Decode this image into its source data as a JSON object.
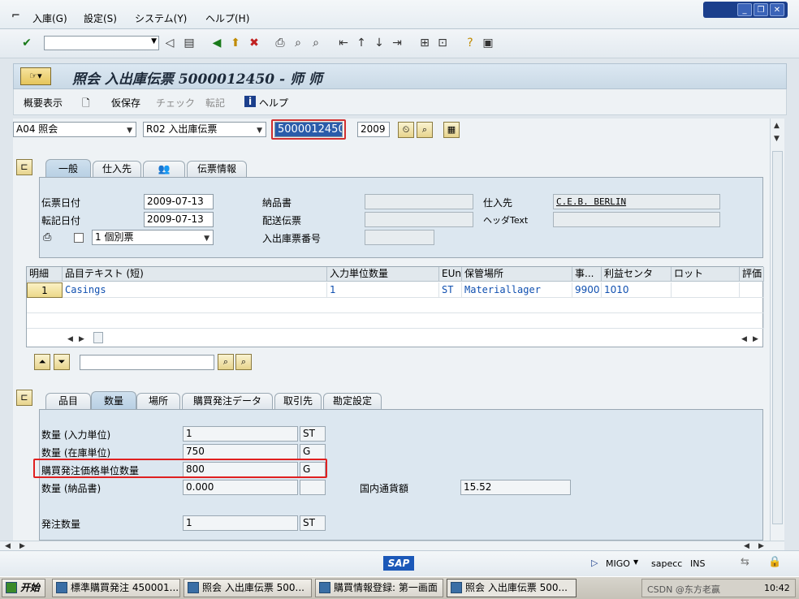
{
  "menubar": {
    "items": [
      "入庫(G)",
      "設定(S)",
      "システム(Y)",
      "ヘルプ(H)"
    ]
  },
  "toolbar": {
    "command_value": ""
  },
  "title": {
    "text": "照会 入出庫伝票 5000012450 - 师 师"
  },
  "app_toolbar": {
    "summary": "概要表示",
    "hold": "仮保存",
    "check": "チェック",
    "post": "転記",
    "help": "ヘルプ"
  },
  "header": {
    "action": "A04 照会",
    "ref_doc_type": "R02 入出庫伝票",
    "doc_number": "5000012450",
    "year": "2009"
  },
  "tabs_top": {
    "items": [
      "一般",
      "仕入先",
      "",
      "伝票情報"
    ],
    "active": 0
  },
  "general": {
    "doc_date_label": "伝票日付",
    "doc_date": "2009-07-13",
    "post_date_label": "転記日付",
    "post_date": "2009-07-13",
    "slip_select": "1 個別票",
    "delivery_note_label": "納品書",
    "bill_of_lading_label": "配送伝票",
    "gr_slip_label": "入出庫票番号",
    "vendor_label": "仕入先",
    "vendor_value": "C.E.B. BERLIN",
    "header_text_label": "ヘッダText"
  },
  "items_grid": {
    "columns": [
      "明細",
      "品目テキスト (短)",
      "入力単位数量",
      "EUn",
      "保管場所",
      "事...",
      "利益センタ",
      "ロット",
      "評価"
    ],
    "rows": [
      {
        "line": "1",
        "text": "Casings",
        "qty": "1",
        "eun": "ST",
        "sloc": "Materiallager",
        "bus": "9900",
        "profit": "1010",
        "batch": "",
        "val": ""
      }
    ]
  },
  "tabs_bottom": {
    "items": [
      "品目",
      "数量",
      "場所",
      "購買発注データ",
      "取引先",
      "勘定設定"
    ],
    "active": 1
  },
  "quantity": {
    "q_entry_label": "数量 (入力単位)",
    "q_entry": "1",
    "q_entry_unit": "ST",
    "q_stock_label": "数量 (在庫単位)",
    "q_stock": "750",
    "q_stock_unit": "G",
    "q_po_price_label": "購買発注価格単位数量",
    "q_po_price": "800",
    "q_po_price_unit": "G",
    "q_delivery_label": "数量 (納品書)",
    "q_delivery": "0.000",
    "q_delivery_unit": "",
    "lc_amount_label": "国内通貨額",
    "lc_amount": "15.52",
    "order_qty_label": "発注数量",
    "order_qty": "1",
    "order_qty_unit": "ST"
  },
  "status": {
    "tcode": "MIGO",
    "system": "sapecc",
    "mode": "INS"
  },
  "taskbar": {
    "start": "开始",
    "tasks": [
      "標準購買発注 450001...",
      "照会 入出庫伝票 500...",
      "購買情報登録: 第一画面",
      "照会 入出庫伝票 500..."
    ],
    "watermark": "CSDN @东方老赢",
    "clock": "10:42"
  },
  "colors": {
    "highlight": "#e02020",
    "link": "#1050b0",
    "sap_blue": "#1b58b8"
  }
}
